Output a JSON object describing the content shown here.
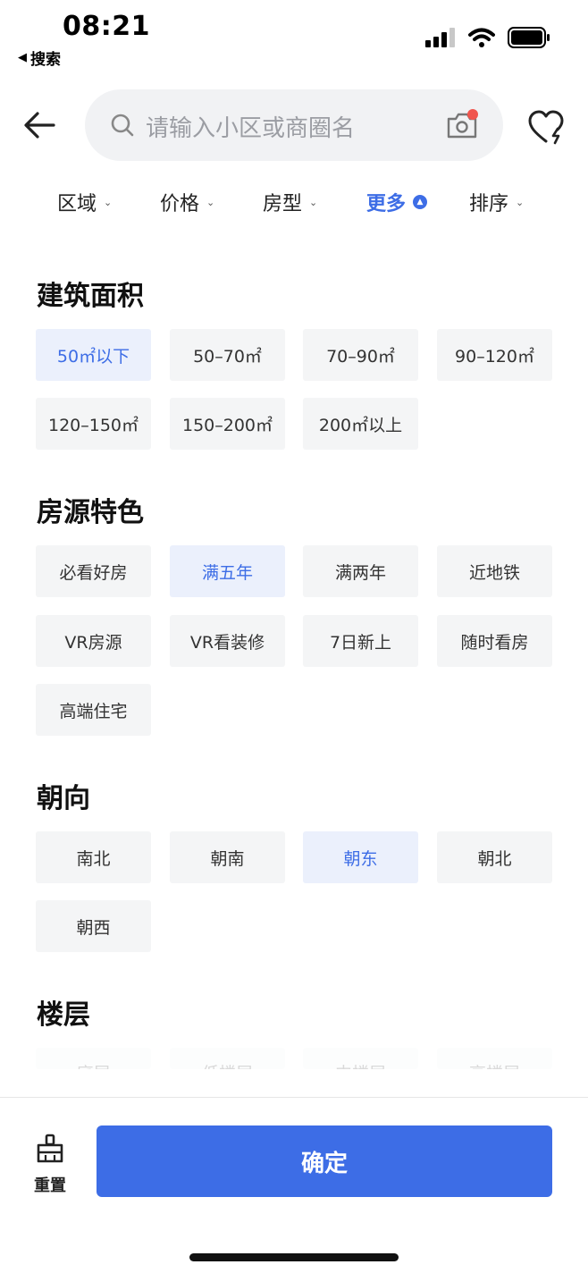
{
  "status_bar": {
    "time": "08:21",
    "back_label": "搜索"
  },
  "search": {
    "placeholder": "请输入小区或商圈名",
    "camera_badge_color": "#f0554d"
  },
  "tabs": [
    {
      "label": "区域",
      "active": false
    },
    {
      "label": "价格",
      "active": false
    },
    {
      "label": "房型",
      "active": false
    },
    {
      "label": "更多",
      "active": true
    },
    {
      "label": "排序",
      "active": false
    }
  ],
  "sections": {
    "area": {
      "title": "建筑面积",
      "options": [
        "50㎡以下",
        "50–70㎡",
        "70–90㎡",
        "90–120㎡",
        "120–150㎡",
        "150–200㎡",
        "200㎡以上"
      ],
      "selected": "50㎡以下"
    },
    "features": {
      "title": "房源特色",
      "options": [
        "必看好房",
        "满五年",
        "满两年",
        "近地铁",
        "VR房源",
        "VR看装修",
        "7日新上",
        "随时看房",
        "高端住宅"
      ],
      "selected": "满五年"
    },
    "orientation": {
      "title": "朝向",
      "options": [
        "南北",
        "朝南",
        "朝东",
        "朝北",
        "朝西"
      ],
      "selected": "朝东"
    },
    "floor": {
      "title": "楼层",
      "options": [
        "底层",
        "低楼层",
        "中楼层",
        "高楼层"
      ]
    }
  },
  "footer": {
    "reset_label": "重置",
    "confirm_label": "确定"
  },
  "colors": {
    "accent": "#3d6de6",
    "chip_bg": "#f4f5f6",
    "chip_selected_bg": "#ebf0fc"
  }
}
